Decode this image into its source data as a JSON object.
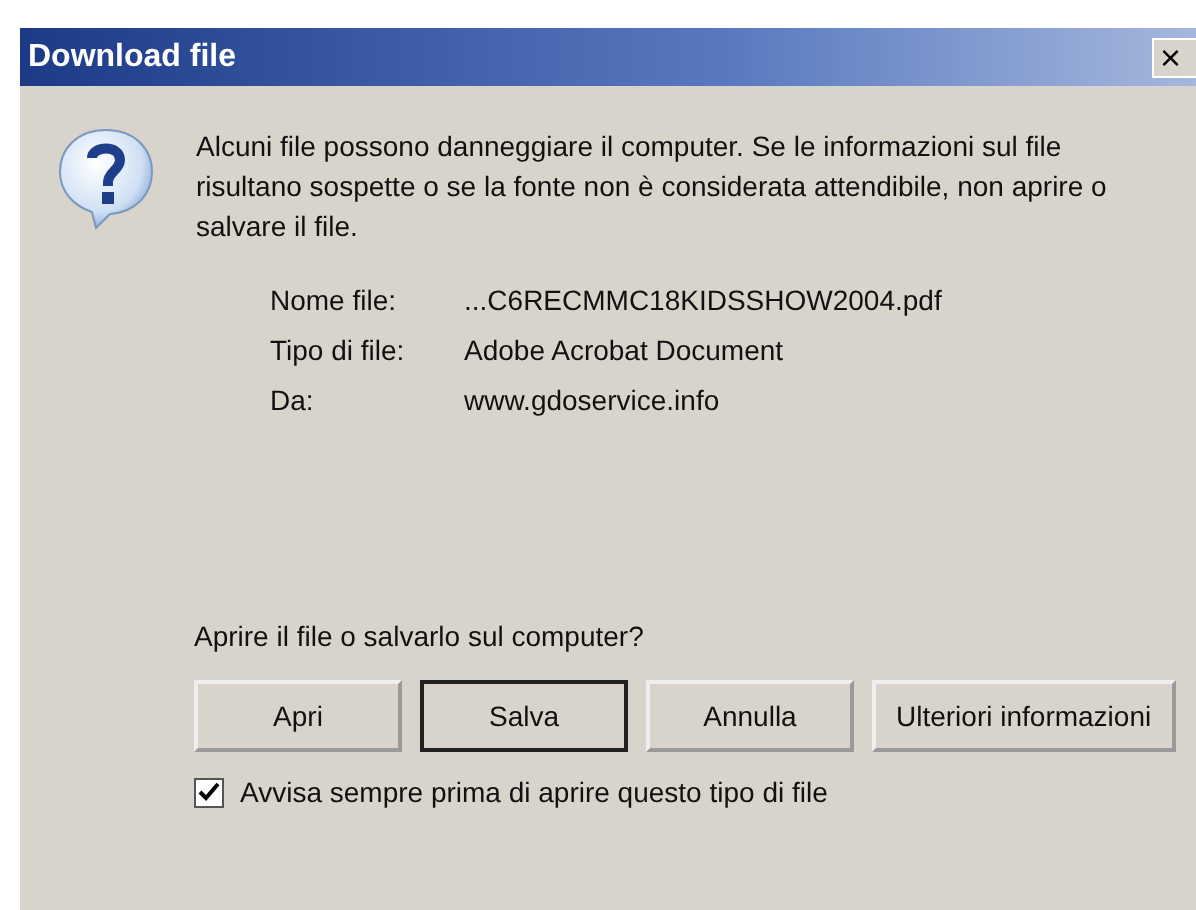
{
  "window": {
    "title": "Download file",
    "close": "×"
  },
  "message": "Alcuni file possono danneggiare il computer. Se le informazioni sul file risultano sospette o se la fonte non è considerata attendibile, non aprire o salvare il file.",
  "details": [
    {
      "label": "Nome file:",
      "value": "...C6RECMMC18KIDSSHOW2004.pdf"
    },
    {
      "label": "Tipo di file:",
      "value": "Adobe Acrobat Document"
    },
    {
      "label": "Da:",
      "value": "www.gdoservice.info"
    }
  ],
  "question": "Aprire il file o salvarlo sul computer?",
  "buttons": [
    {
      "label": "Apri",
      "default": false
    },
    {
      "label": "Salva",
      "default": true
    },
    {
      "label": "Annulla",
      "default": false
    },
    {
      "label": "Ulteriori informazioni",
      "default": false
    }
  ],
  "checkbox": {
    "label": "Avvisa sempre prima di aprire questo tipo di file",
    "checked": true
  }
}
